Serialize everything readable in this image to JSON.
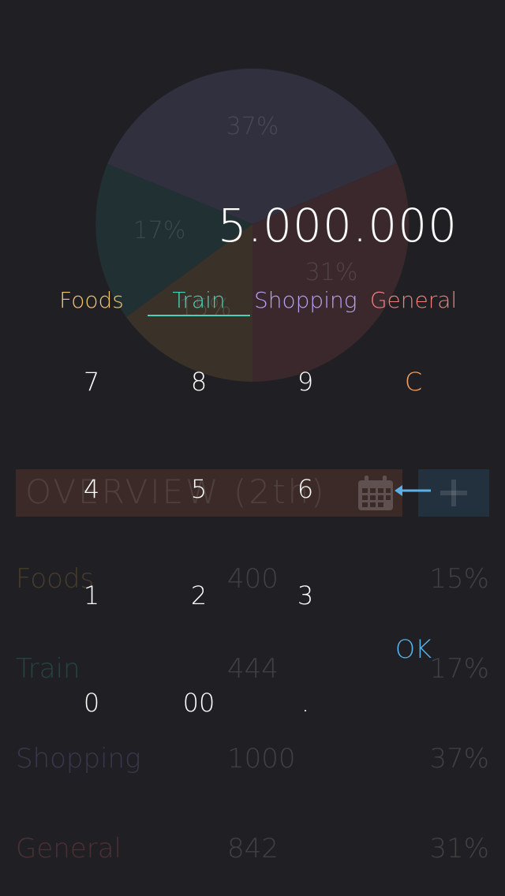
{
  "background": {
    "pie": {
      "slices": [
        {
          "category": "Shopping",
          "label": "37%",
          "color": "#30303f"
        },
        {
          "category": "General",
          "label": "31%",
          "color": "#3a282c"
        },
        {
          "category": "Foods",
          "label": "15%",
          "color": "#3a3228"
        },
        {
          "category": "Train",
          "label": "17%",
          "color": "#203033"
        }
      ]
    },
    "overview": {
      "title": "OVERVIEW (2th)",
      "calendar_icon": "calendar-icon",
      "add_icon": "plus-icon"
    },
    "summary": [
      {
        "name": "Foods",
        "amount": "400",
        "percent": "15%",
        "color": "#c9a24a"
      },
      {
        "name": "Train",
        "amount": "444",
        "percent": "17%",
        "color": "#3dbfa8"
      },
      {
        "name": "Shopping",
        "amount": "1000",
        "percent": "37%",
        "color": "#9a86e0"
      },
      {
        "name": "General",
        "amount": "842",
        "percent": "31%",
        "color": "#e06a6a"
      }
    ]
  },
  "input": {
    "amount": "5.000.000",
    "categories": [
      {
        "label": "Foods",
        "color": "#f2c66b"
      },
      {
        "label": "Train",
        "color": "#48d0b8"
      },
      {
        "label": "Shopping",
        "color": "#b7a2f2"
      },
      {
        "label": "General",
        "color": "#f07f7f"
      }
    ],
    "selected_category": "Train",
    "keys": {
      "k7": "7",
      "k8": "8",
      "k9": "9",
      "clear": "C",
      "k4": "4",
      "k5": "5",
      "k6": "6",
      "backspace_icon": "arrow-left-icon",
      "k1": "1",
      "k2": "2",
      "k3": "3",
      "ok": "OK",
      "k0": "0",
      "k00": "00",
      "dot": "."
    },
    "colors": {
      "clear": "#f0a066",
      "ok": "#5ab0e8",
      "backspace": "#5ab0e8"
    }
  }
}
